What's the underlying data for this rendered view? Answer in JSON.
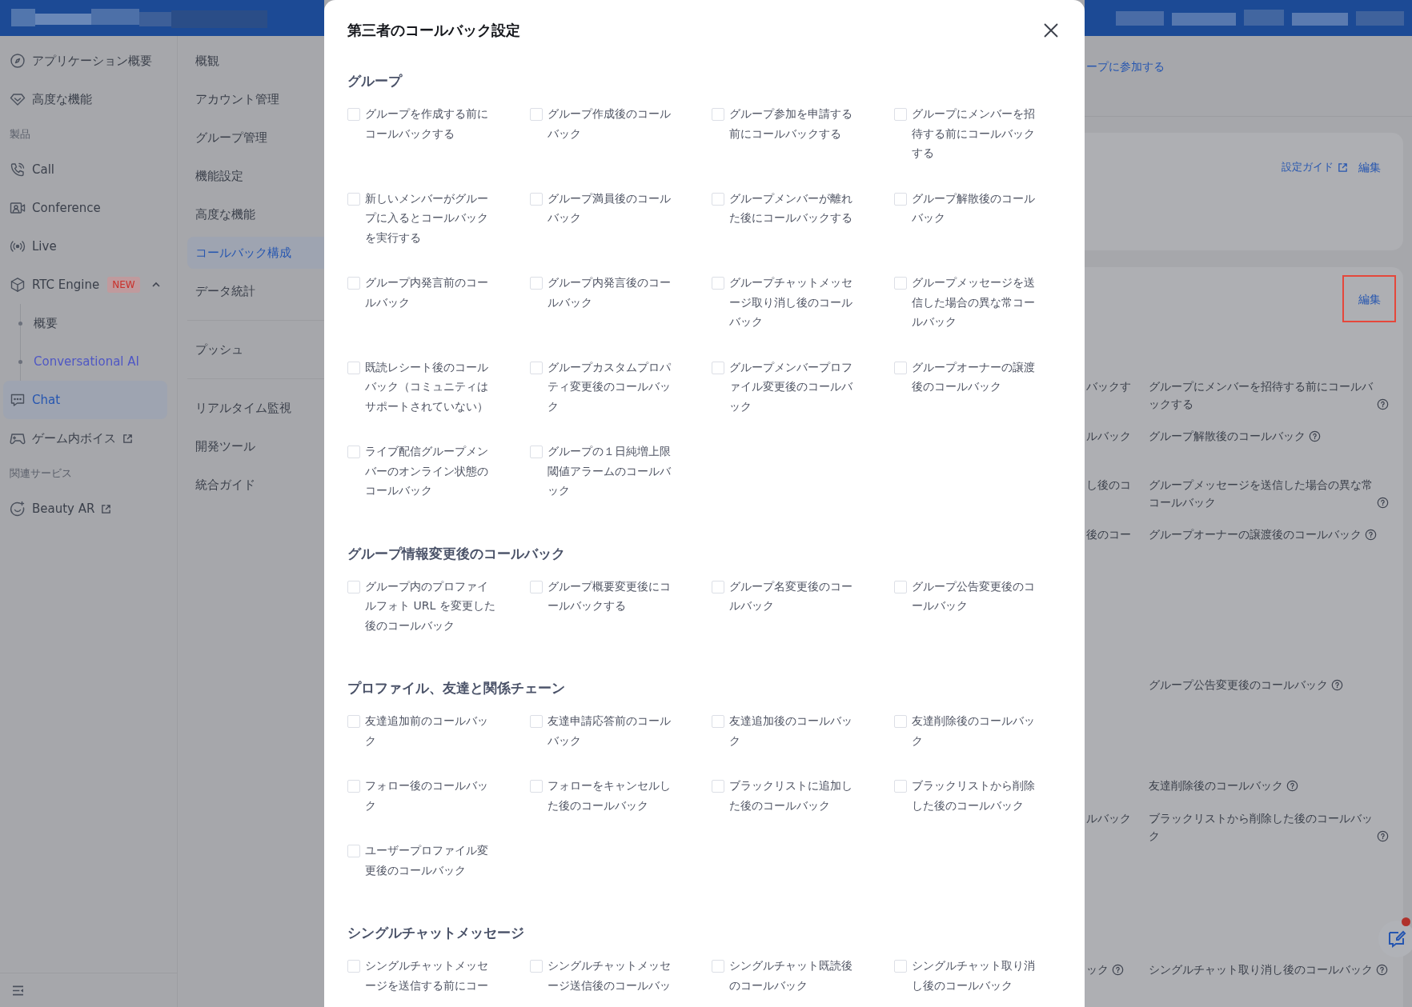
{
  "sidebar": {
    "items": [
      {
        "kind": "item",
        "label": "アプリケーション概要",
        "selected": false,
        "external": false
      },
      {
        "kind": "item",
        "label": "高度な機能",
        "selected": false,
        "external": false
      },
      {
        "kind": "heading",
        "label": "製品"
      },
      {
        "kind": "item",
        "label": "Call",
        "selected": false,
        "external": false
      },
      {
        "kind": "item",
        "label": "Conference",
        "selected": false,
        "external": false
      },
      {
        "kind": "item",
        "label": "Live",
        "selected": false,
        "external": false
      },
      {
        "kind": "item",
        "label": "RTC Engine",
        "selected": false,
        "external": false,
        "badge": "NEW",
        "expanded": true,
        "children": [
          {
            "label": "概要",
            "selected": false,
            "accent": false
          },
          {
            "label": "Conversational AI",
            "selected": false,
            "accent": true
          }
        ]
      },
      {
        "kind": "item",
        "label": "Chat",
        "selected": true,
        "external": false
      },
      {
        "kind": "item",
        "label": "ゲーム内ボイス",
        "selected": false,
        "external": true
      },
      {
        "kind": "heading",
        "label": "関連サービス"
      },
      {
        "kind": "item",
        "label": "Beauty AR",
        "selected": false,
        "external": true
      }
    ]
  },
  "subnav": {
    "groups": [
      [
        {
          "label": "概観",
          "selected": false
        },
        {
          "label": "アカウント管理",
          "selected": false
        },
        {
          "label": "グループ管理",
          "selected": false
        },
        {
          "label": "機能設定",
          "selected": false
        },
        {
          "label": "高度な機能",
          "selected": false
        },
        {
          "label": "コールバック構成",
          "selected": true
        },
        {
          "label": "データ統計",
          "selected": false
        }
      ],
      [
        {
          "label": "プッシュ",
          "selected": false
        }
      ],
      [
        {
          "label": "リアルタイム監視",
          "selected": false
        },
        {
          "label": "開発ツール",
          "selected": false
        },
        {
          "label": "統合ガイド",
          "selected": false
        }
      ]
    ]
  },
  "modal": {
    "title": "第三者のコールバック設定",
    "sections": [
      {
        "heading": "グループ",
        "options": [
          {
            "label": "グループを作成する前にコールバックする",
            "checked": false
          },
          {
            "label": "グループ作成後のコールバック",
            "checked": false
          },
          {
            "label": "グループ参加を申請する前にコールバックする",
            "checked": false
          },
          {
            "label": "グループにメンバーを招待する前にコールバックする",
            "checked": false
          },
          {
            "label": "新しいメンバーがグループに入るとコールバックを実行する",
            "checked": false
          },
          {
            "label": "グループ満員後のコールバック",
            "checked": false
          },
          {
            "label": "グループメンバーが離れた後にコールバックする",
            "checked": false
          },
          {
            "label": "グループ解散後のコールバック",
            "checked": false
          },
          {
            "label": "グループ内発言前のコールバック",
            "checked": false
          },
          {
            "label": "グループ内発言後のコールバック",
            "checked": false
          },
          {
            "label": "グループチャットメッセージ取り消し後のコールバック",
            "checked": false
          },
          {
            "label": "グループメッセージを送信した場合の異な常コールバック",
            "checked": false
          },
          {
            "label": "既読レシート後のコールバック（コミュニティはサポートされていない）",
            "checked": false
          },
          {
            "label": "グループカスタムプロパティ変更後のコールバック",
            "checked": false
          },
          {
            "label": "グループメンバープロファイル変更後のコールバック",
            "checked": false
          },
          {
            "label": "グループオーナーの譲渡後のコールバック",
            "checked": false
          },
          {
            "label": "ライブ配信グループメンバーのオンライン状態のコールバック",
            "checked": false
          },
          {
            "label": "グループの１日純増上限閾値アラームのコールバック",
            "checked": false
          }
        ]
      },
      {
        "heading": "グループ情報変更後のコールバック",
        "options": [
          {
            "label": "グループ内のプロファイルフォト URL を変更した後のコールバック",
            "checked": false
          },
          {
            "label": "グループ概要変更後にコールバックする",
            "checked": false
          },
          {
            "label": "グループ名変更後のコールバック",
            "checked": false
          },
          {
            "label": "グループ公告変更後のコールバック",
            "checked": false
          }
        ]
      },
      {
        "heading": "プロファイル、友達と関係チェーン",
        "options": [
          {
            "label": "友達追加前のコールバック",
            "checked": false
          },
          {
            "label": "友達申請応答前のコールバック",
            "checked": false
          },
          {
            "label": "友達追加後のコールバック",
            "checked": false
          },
          {
            "label": "友達削除後のコールバック",
            "checked": false
          },
          {
            "label": "フォロー後のコールバック",
            "checked": false
          },
          {
            "label": "フォローをキャンセルした後のコールバック",
            "checked": false
          },
          {
            "label": "ブラックリストに追加した後のコールバック",
            "checked": false
          },
          {
            "label": "ブラックリストから削除した後のコールバック",
            "checked": false
          },
          {
            "label": "ユーザープロファイル変更後のコールバック",
            "checked": false
          }
        ]
      },
      {
        "heading": "シングルチャットメッセージ",
        "options": [
          {
            "label": "シングルチャットメッセージを送信する前にコー",
            "checked": false
          },
          {
            "label": "シングルチャットメッセージ送信後のコールバッ",
            "checked": false
          },
          {
            "label": "シングルチャット既読後のコールバック",
            "checked": false
          },
          {
            "label": "シングルチャット取り消し後のコールバック",
            "checked": false
          }
        ]
      }
    ]
  },
  "background": {
    "join_link": "ープに参加する",
    "guide_card": {
      "guide_link": "設定ガイド",
      "edit_link": "編集"
    },
    "callback_card": {
      "edit_link": "編集",
      "highlighted": true,
      "rows": [
        {
          "column_1": "バックす",
          "column_1_help": false,
          "column_2": "グループにメンバーを招待する前にコールバックする",
          "column_2_help": true
        },
        {
          "column_1": "ルバック",
          "column_1_help": false,
          "column_2": "グループ解散後のコールバック",
          "column_2_help": true
        },
        {
          "column_1": "し後のコ",
          "column_1_help": false,
          "column_2": "グループメッセージを送信した場合の異な常コールバック",
          "column_2_help": true
        },
        {
          "column_1": "後のコー",
          "column_1_help": false,
          "column_2": "グループオーナーの譲渡後のコールバック",
          "column_2_help": true
        },
        {
          "column_2": "グループ公告変更後のコールバック",
          "column_2_help": true
        },
        {
          "column_2": "友達削除後のコールバック",
          "column_2_help": true
        },
        {
          "column_1": "ルバック",
          "column_1_help": false,
          "column_2": "ブラックリストから削除した後のコールバック",
          "column_2_help": true
        },
        {
          "column_1": "ック",
          "column_1_help": true,
          "column_2": "シングルチャット取り消し後のコールバック",
          "column_2_help": true
        }
      ]
    }
  }
}
